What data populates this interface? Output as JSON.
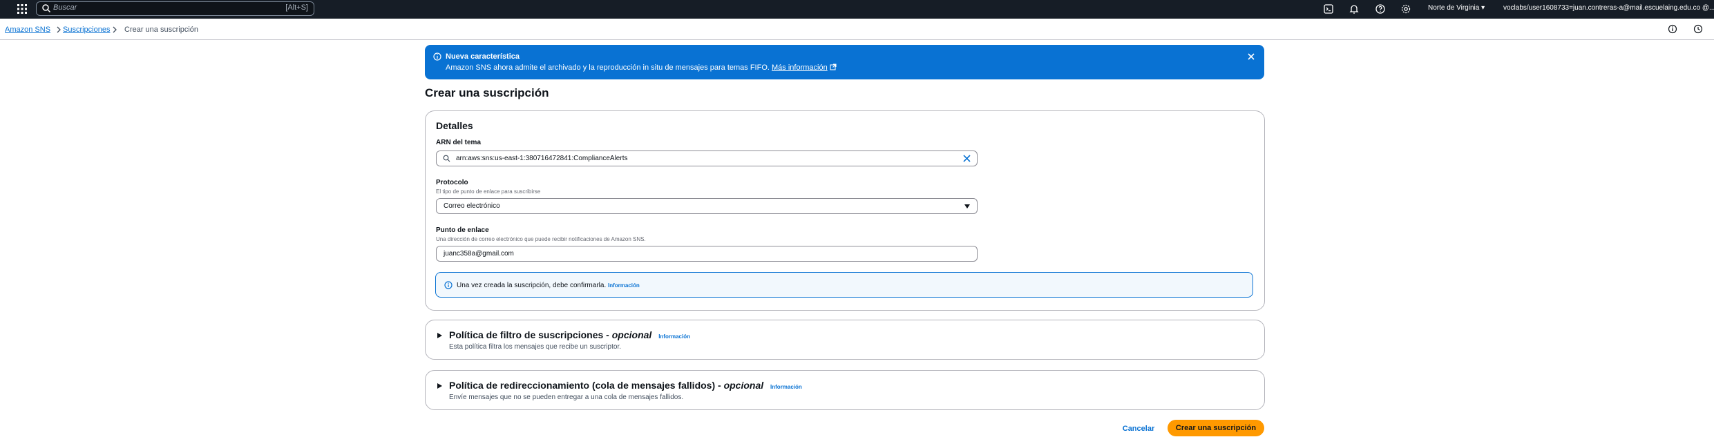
{
  "topbar": {
    "search_placeholder": "Buscar",
    "search_shortcut": "[Alt+S]",
    "region": "Norte de Virginia ▾",
    "account": "voclabs/user1608733=juan.contreras-a@mail.escuelaing.edu.co @..."
  },
  "breadcrumb": {
    "items": [
      "Amazon SNS",
      "Suscripciones",
      "Crear una suscripción"
    ]
  },
  "flash": {
    "title": "Nueva característica",
    "message": "Amazon SNS ahora admite el archivado y la reproducción in situ de mensajes para temas FIFO.",
    "link": "Más información"
  },
  "page_title": "Crear una suscripción",
  "details": {
    "title": "Detalles",
    "topic_arn_label": "ARN del tema",
    "topic_arn_value": "arn:aws:sns:us-east-1:380716472841:ComplianceAlerts",
    "protocol_label": "Protocolo",
    "protocol_desc": "El tipo de punto de enlace para suscribirse",
    "protocol_value": "Correo electrónico",
    "endpoint_label": "Punto de enlace",
    "endpoint_desc": "Una dirección de correo electrónico que puede recibir notificaciones de Amazon SNS.",
    "endpoint_value": "juanc358a@gmail.com",
    "confirm_note": "Una vez creada la suscripción, debe confirmarla.",
    "confirm_link": "Información"
  },
  "filter_policy": {
    "title": "Política de filtro de suscripciones - ",
    "optional": "opcional",
    "info": "Información",
    "desc": "Esta política filtra los mensajes que recibe un suscriptor."
  },
  "redrive_policy": {
    "title": "Política de redireccionamiento (cola de mensajes fallidos) - ",
    "optional": "opcional",
    "info": "Información",
    "desc": "Envíe mensajes que no se pueden entregar a una cola de mensajes fallidos."
  },
  "actions": {
    "cancel": "Cancelar",
    "submit": "Crear una suscripción"
  },
  "colors": {
    "topbar": "#161d26",
    "link": "#0972d3",
    "primary": "#ff9900",
    "flash": "#0972d3"
  }
}
